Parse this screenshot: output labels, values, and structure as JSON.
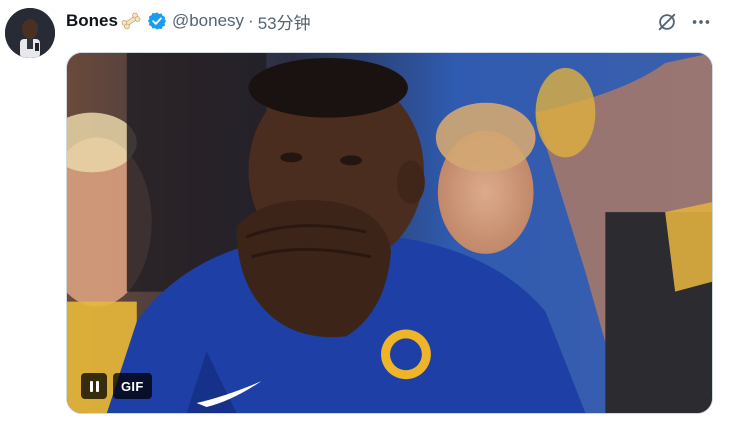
{
  "tweet": {
    "author_name": "Bones",
    "author_emoji_icon": "bone-icon",
    "verified_icon": "verified-badge-icon",
    "handle": "@bonesy",
    "separator": "·",
    "time": "53分钟"
  },
  "actions": {
    "grok_icon": "grok-icon",
    "more_icon": "more-icon"
  },
  "media": {
    "type": "gif",
    "badge_label": "GIF",
    "pause_icon": "pause-icon"
  },
  "colors": {
    "verified_blue": "#1d9bf0",
    "jersey_blue": "#1d3fa6",
    "secondary_text": "#536471"
  }
}
